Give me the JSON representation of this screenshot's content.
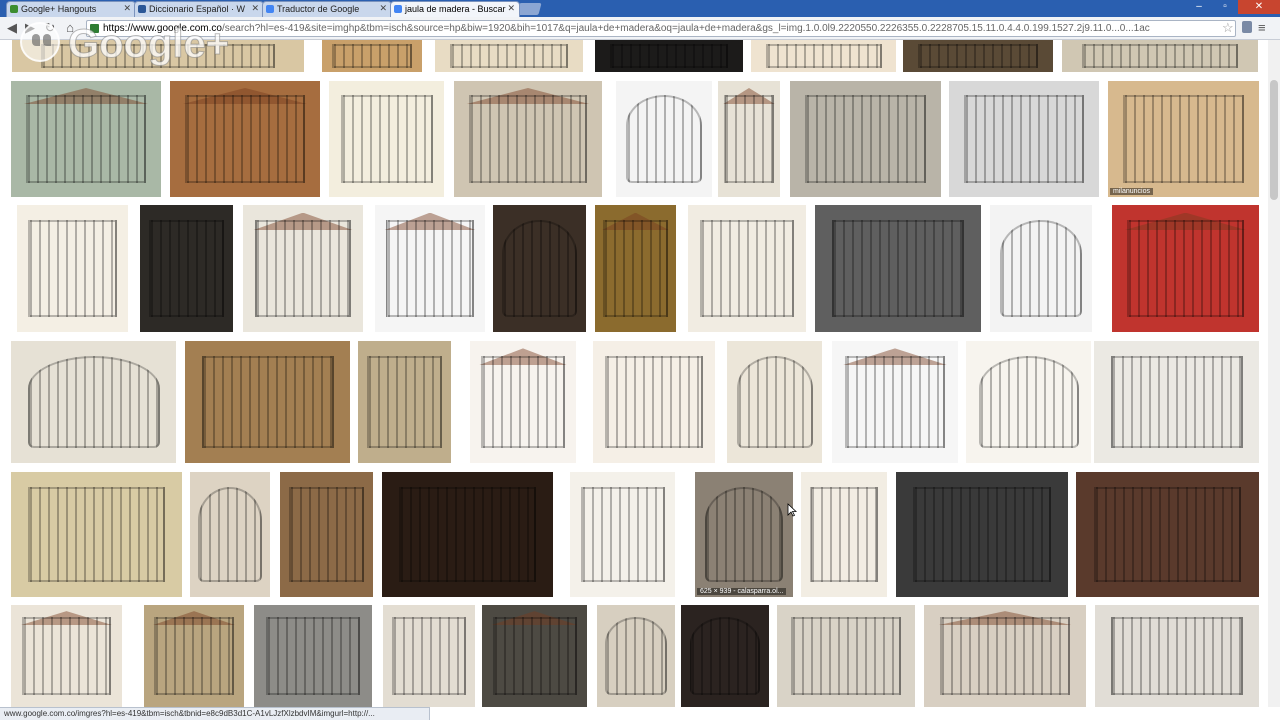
{
  "browser": {
    "tabs": [
      {
        "label": "Google+ Hangouts",
        "color": "#3c8d2f"
      },
      {
        "label": "Diccionario Español · W",
        "color": "#2b5797"
      },
      {
        "label": "Traductor de Google",
        "color": "#4285f4"
      },
      {
        "label": "jaula de madera - Buscar",
        "color": "#4285f4"
      }
    ],
    "url_host": "https://www.google.com.co",
    "url_rest": "/search?hl=es-419&site=imghp&tbm=isch&source=hp&biw=1920&bih=1017&q=jaula+de+madera&oq=jaula+de+madera&gs_l=img.1.0.0l9.2220550.2226355.0.2228705.15.11.0.4.4.0.199.1527.2j9.11.0...0...1ac",
    "status_url": "www.google.com.co/imgres?hl=es-419&tbm=isch&tbnid=e8c9dB3d1C-A1vLJzfXlzbdvIM&imgurl=http://...",
    "overlay_logo_text": "Google+"
  },
  "results": [
    {
      "caption": "",
      "bg": "#d9c7a3",
      "style": "bars"
    },
    {
      "caption": "",
      "bg": "#c9a06a",
      "style": "bars"
    },
    {
      "caption": "",
      "bg": "#e8dcc4",
      "style": "bars"
    },
    {
      "caption": "",
      "bg": "#1c1b1a",
      "style": "bars"
    },
    {
      "caption": "",
      "bg": "#efe3d0",
      "style": "bars"
    },
    {
      "caption": "",
      "bg": "#5a4a36",
      "style": "bars"
    },
    {
      "caption": "",
      "bg": "#d0c7b3",
      "style": "bars"
    },
    {
      "caption": "",
      "bg": "#a9b8a6",
      "style": "roof"
    },
    {
      "caption": "",
      "bg": "#a66d3f",
      "style": "roof"
    },
    {
      "caption": "",
      "bg": "#f3eede",
      "style": "bars"
    },
    {
      "caption": "",
      "bg": "#cfc5b2",
      "style": "roof"
    },
    {
      "caption": "",
      "bg": "#f4f4f4",
      "style": "round"
    },
    {
      "caption": "",
      "bg": "#e7e2d6",
      "style": "roof"
    },
    {
      "caption": "",
      "bg": "#b9b4a8",
      "style": "bars"
    },
    {
      "caption": "",
      "bg": "#d8d8d8",
      "style": "bars"
    },
    {
      "caption": "milanuncios",
      "bg": "#d7b98e",
      "style": "bars"
    },
    {
      "caption": "",
      "bg": "#f4efe4",
      "style": "bars"
    },
    {
      "caption": "",
      "bg": "#2d2a26",
      "style": "bars"
    },
    {
      "caption": "",
      "bg": "#eae6dc",
      "style": "roof"
    },
    {
      "caption": "",
      "bg": "#f5f5f5",
      "style": "roof"
    },
    {
      "caption": "",
      "bg": "#3b2f26",
      "style": "round"
    },
    {
      "caption": "",
      "bg": "#8b6b2e",
      "style": "roof"
    },
    {
      "caption": "",
      "bg": "#f1ece2",
      "style": "bars"
    },
    {
      "caption": "",
      "bg": "#5f5f5f",
      "style": "bars"
    },
    {
      "caption": "",
      "bg": "#f3f3f3",
      "style": "round"
    },
    {
      "caption": "",
      "bg": "#c0342e",
      "style": "roof"
    },
    {
      "caption": "",
      "bg": "#e6e1d5",
      "style": "round"
    },
    {
      "caption": "",
      "bg": "#a37f52",
      "style": "bars"
    },
    {
      "caption": "",
      "bg": "#bfae8c",
      "style": "bars"
    },
    {
      "caption": "",
      "bg": "#f7f3ee",
      "style": "roof"
    },
    {
      "caption": "",
      "bg": "#f5efe6",
      "style": "bars"
    },
    {
      "caption": "",
      "bg": "#ece6d9",
      "style": "round"
    },
    {
      "caption": "",
      "bg": "#f6f6f6",
      "style": "roof"
    },
    {
      "caption": "",
      "bg": "#f7f4ee",
      "style": "round"
    },
    {
      "caption": "",
      "bg": "#ebe9e3",
      "style": "bars"
    },
    {
      "caption": "",
      "bg": "#d8cba4",
      "style": "bars"
    },
    {
      "caption": "",
      "bg": "#ddd3c3",
      "style": "round"
    },
    {
      "caption": "",
      "bg": "#8c6a47",
      "style": "bars"
    },
    {
      "caption": "",
      "bg": "#2a1c14",
      "style": "bars"
    },
    {
      "caption": "",
      "bg": "#f4f1ea",
      "style": "bars"
    },
    {
      "caption": "625 × 939 - calasparra.ol...",
      "bg": "#8b8174",
      "style": "round"
    },
    {
      "caption": "",
      "bg": "#f2ede3",
      "style": "bars"
    },
    {
      "caption": "",
      "bg": "#3a3a3a",
      "style": "bars"
    },
    {
      "caption": "",
      "bg": "#5a3a2c",
      "style": "bars"
    },
    {
      "caption": "",
      "bg": "#ebe4d8",
      "style": "roof"
    },
    {
      "caption": "",
      "bg": "#b9a57f",
      "style": "roof"
    },
    {
      "caption": "",
      "bg": "#8d8c88",
      "style": "bars"
    },
    {
      "caption": "",
      "bg": "#e3ddd2",
      "style": "bars"
    },
    {
      "caption": "",
      "bg": "#4d4a43",
      "style": "roof"
    },
    {
      "caption": "",
      "bg": "#d7cfc0",
      "style": "round"
    },
    {
      "caption": "",
      "bg": "#2b2320",
      "style": "round"
    },
    {
      "caption": "",
      "bg": "#d9d3c7",
      "style": "bars"
    },
    {
      "caption": "",
      "bg": "#d8cfc2",
      "style": "roof"
    },
    {
      "caption": "",
      "bg": "#e1ddd6",
      "style": "bars"
    }
  ]
}
